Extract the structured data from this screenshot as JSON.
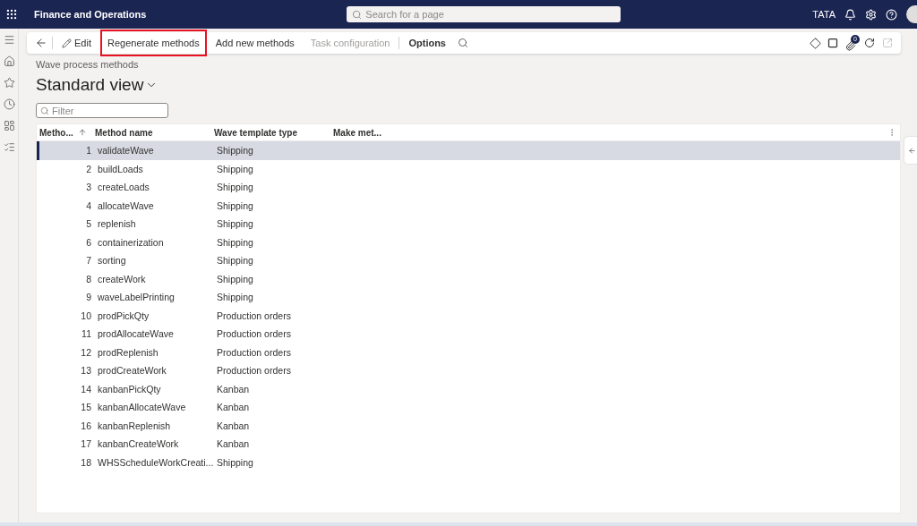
{
  "app_bar": {
    "title": "Finance and Operations",
    "search": {
      "placeholder": "Search for a page"
    },
    "company": "TATA"
  },
  "action_pane": {
    "items": [
      {
        "label": "Edit",
        "kind": "edit",
        "disabled": false,
        "highlighted": false
      },
      {
        "label": "Regenerate methods",
        "kind": "plain",
        "disabled": false,
        "highlighted": true
      },
      {
        "label": "Add new methods",
        "kind": "plain",
        "disabled": false,
        "highlighted": false
      },
      {
        "label": "Task configuration",
        "kind": "plain",
        "disabled": true,
        "highlighted": false
      },
      {
        "label": "Options",
        "kind": "bold",
        "disabled": false,
        "highlighted": false
      }
    ],
    "attachments_badge": "0"
  },
  "page": {
    "caption": "Wave process methods",
    "view_title": "Standard view",
    "filter": {
      "placeholder": "Filter"
    }
  },
  "table": {
    "columns": [
      {
        "label": "Metho...",
        "sorted": true
      },
      {
        "label": "Method name",
        "sorted": false
      },
      {
        "label": "Wave template type",
        "sorted": false
      },
      {
        "label": "Make met...",
        "sorted": false
      }
    ],
    "rows": [
      {
        "sequence": "1",
        "method_name": "validateWave",
        "wave_template_type": "Shipping",
        "selected": true
      },
      {
        "sequence": "2",
        "method_name": "buildLoads",
        "wave_template_type": "Shipping",
        "selected": false
      },
      {
        "sequence": "3",
        "method_name": "createLoads",
        "wave_template_type": "Shipping",
        "selected": false
      },
      {
        "sequence": "4",
        "method_name": "allocateWave",
        "wave_template_type": "Shipping",
        "selected": false
      },
      {
        "sequence": "5",
        "method_name": "replenish",
        "wave_template_type": "Shipping",
        "selected": false
      },
      {
        "sequence": "6",
        "method_name": "containerization",
        "wave_template_type": "Shipping",
        "selected": false
      },
      {
        "sequence": "7",
        "method_name": "sorting",
        "wave_template_type": "Shipping",
        "selected": false
      },
      {
        "sequence": "8",
        "method_name": "createWork",
        "wave_template_type": "Shipping",
        "selected": false
      },
      {
        "sequence": "9",
        "method_name": "waveLabelPrinting",
        "wave_template_type": "Shipping",
        "selected": false
      },
      {
        "sequence": "10",
        "method_name": "prodPickQty",
        "wave_template_type": "Production orders",
        "selected": false
      },
      {
        "sequence": "11",
        "method_name": "prodAllocateWave",
        "wave_template_type": "Production orders",
        "selected": false
      },
      {
        "sequence": "12",
        "method_name": "prodReplenish",
        "wave_template_type": "Production orders",
        "selected": false
      },
      {
        "sequence": "13",
        "method_name": "prodCreateWork",
        "wave_template_type": "Production orders",
        "selected": false
      },
      {
        "sequence": "14",
        "method_name": "kanbanPickQty",
        "wave_template_type": "Kanban",
        "selected": false
      },
      {
        "sequence": "15",
        "method_name": "kanbanAllocateWave",
        "wave_template_type": "Kanban",
        "selected": false
      },
      {
        "sequence": "16",
        "method_name": "kanbanReplenish",
        "wave_template_type": "Kanban",
        "selected": false
      },
      {
        "sequence": "17",
        "method_name": "kanbanCreateWork",
        "wave_template_type": "Kanban",
        "selected": false
      },
      {
        "sequence": "18",
        "method_name": "WHSScheduleWorkCreati...",
        "wave_template_type": "Shipping",
        "selected": false
      }
    ]
  }
}
